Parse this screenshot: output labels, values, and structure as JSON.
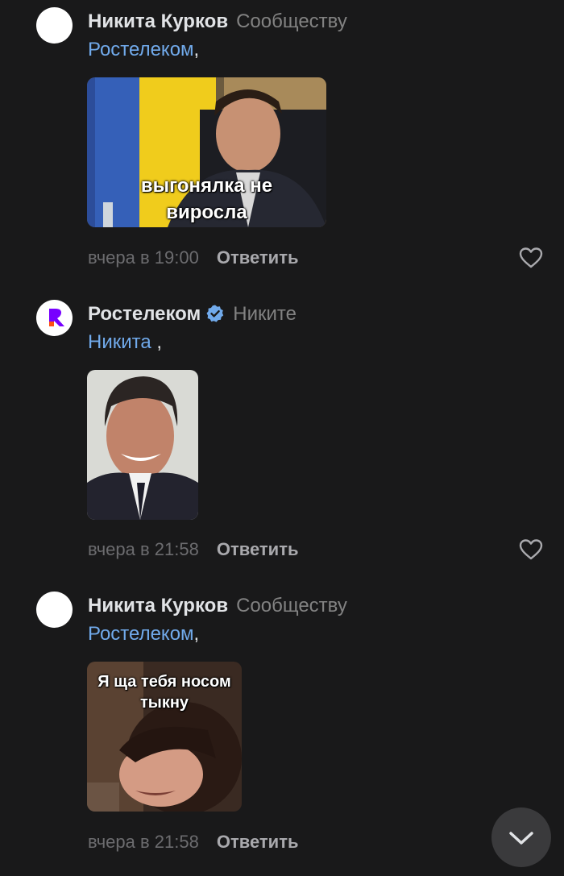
{
  "comments": [
    {
      "author": "Никита Курков",
      "reply_to": "Сообществу",
      "mention": "Ростелеком",
      "mention_suffix": ",",
      "meme_caption_lines": [
        "выгонялка не",
        "виросла"
      ],
      "time": "вчера в 19:00",
      "reply_label": "Ответить",
      "liked": false
    },
    {
      "author": "Ростелеком",
      "verified": true,
      "reply_to": "Никите",
      "mention": "Никита",
      "mention_suffix": " ,",
      "meme_caption_lines": [],
      "time": "вчера в 21:58",
      "reply_label": "Ответить",
      "liked": false
    },
    {
      "author": "Никита Курков",
      "reply_to": "Сообществу",
      "mention": "Ростелеком",
      "mention_suffix": ",",
      "meme_caption_lines": [
        "Я ща тебя носом",
        "тыкну"
      ],
      "time": "вчера в 21:58",
      "reply_label": "Ответить",
      "liked": false
    }
  ],
  "icons": {
    "like": "heart-outline-icon",
    "verified": "verified-check-icon",
    "scroll": "chevron-down-icon",
    "brand_logo": "rostelecom-logo-icon"
  },
  "colors": {
    "background": "#19191a",
    "link": "#71aaeb",
    "muted": "#828282",
    "verified": "#71aaeb",
    "brand_purple": "#7700ff",
    "brand_orange": "#ff4f12"
  }
}
